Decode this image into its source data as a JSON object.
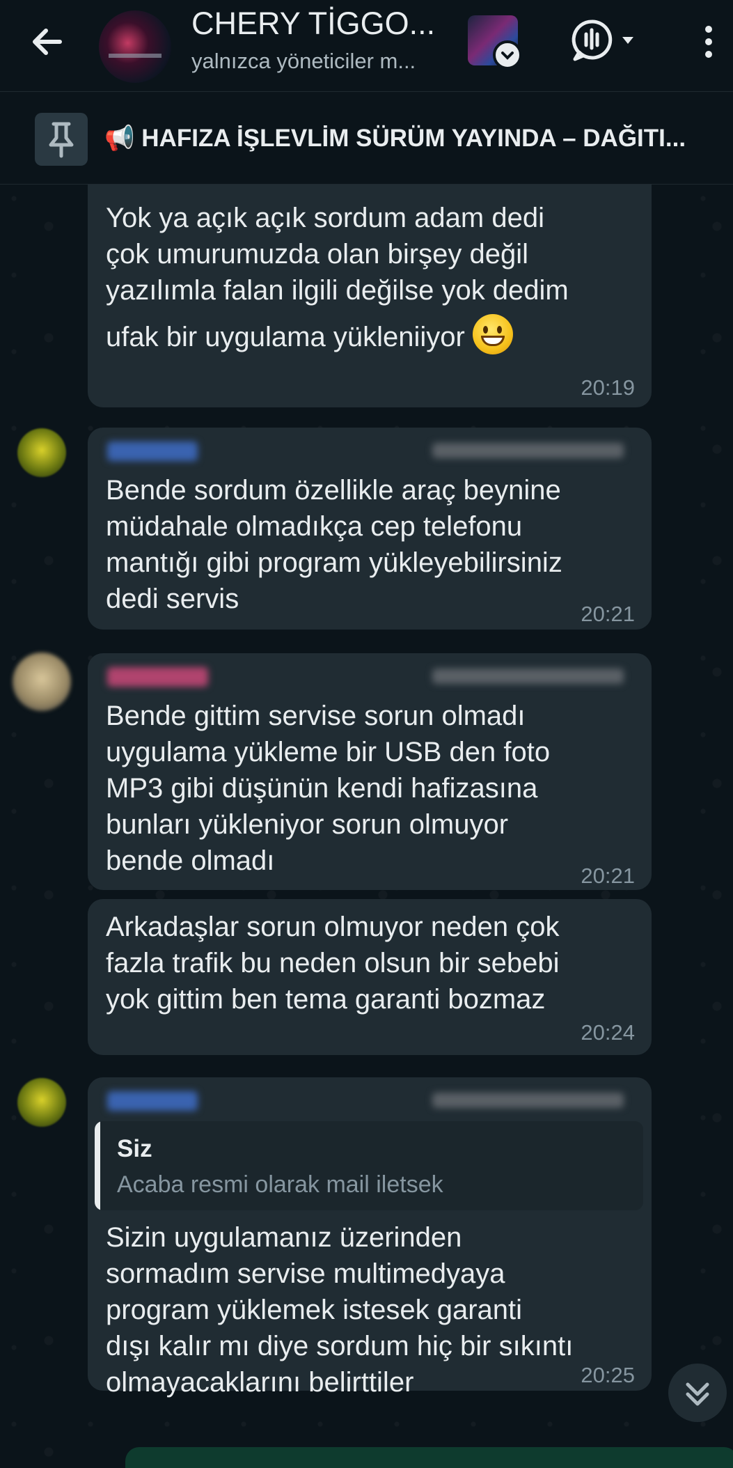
{
  "header": {
    "title": "CHERY TİGGO...",
    "subtitle": "yalnızca yöneticiler m..."
  },
  "pinned": {
    "text": "📢 HAFIZA İŞLEVLİM SÜRÜM YAYINDA – DAĞITI..."
  },
  "messages": [
    {
      "lines": [
        "Yok ya açık açık sordum adam dedi",
        "çok umurumuzda olan birşey değil",
        "yazılımla falan ilgili değilse yok dedim",
        "ufak bir uygulama yükleniiyor"
      ],
      "emoji": "grinning-face",
      "time": "20:19"
    },
    {
      "lines": [
        "Bende sordum özellikle araç beynine",
        "müdahale olmadıkça cep telefonu",
        "mantığı gibi program yükleyebilirsiniz",
        "dedi servis"
      ],
      "time": "20:21"
    },
    {
      "lines": [
        "Bende gittim servise sorun olmadı",
        "uygulama yükleme bir USB den foto",
        "MP3 gibi düşünün kendi hafizasına",
        "bunları yükleniyor sorun olmuyor",
        "bende olmadı"
      ],
      "time": "20:21"
    },
    {
      "lines": [
        "Arkadaşlar sorun olmuyor neden çok",
        "fazla trafik bu neden olsun bir sebebi",
        "yok gittim ben tema garanti bozmaz"
      ],
      "time": "20:24"
    },
    {
      "quote": {
        "author": "Siz",
        "text": "Acaba resmi olarak mail iletsek"
      },
      "lines": [
        "Sizin uygulamanız üzerinden",
        "sormadım servise multimedyaya",
        "program yüklemek istesek garanti",
        "dışı kalır mı diye sordum hiç bir sıkıntı",
        "olmayacaklarını belirttiler"
      ],
      "time": "20:25"
    }
  ],
  "icons": {
    "back": "arrow-left-icon",
    "voice_chat": "voice-chat-icon",
    "more": "more-vert-icon",
    "pin": "pin-icon",
    "scroll": "double-chevron-down-icon"
  },
  "colors": {
    "background": "#0b141a",
    "bubble": "#202c33",
    "text": "#e9edef",
    "meta": "#8696a0"
  }
}
